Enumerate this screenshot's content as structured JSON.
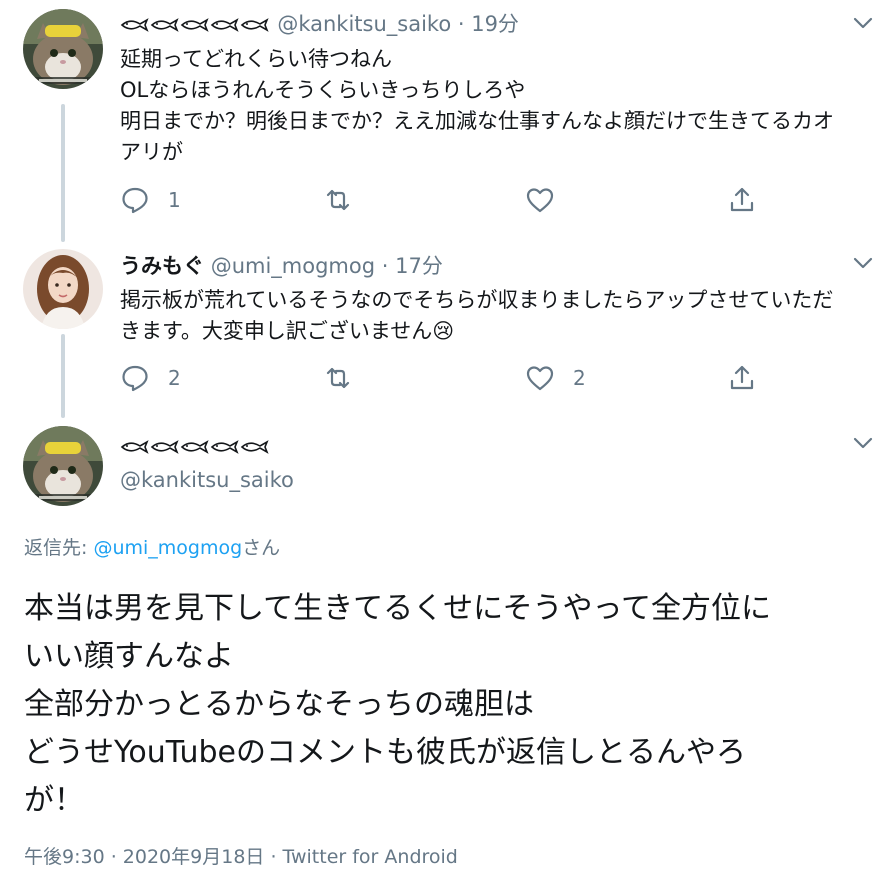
{
  "tweets": [
    {
      "display_name": "🐟🐟🐟🐟🐟",
      "handle": "@kankitsu_saiko",
      "time": "· 19分",
      "lines": [
        "延期ってどれくらい待つねん",
        "OLならほうれんそうくらいきっちりしろや",
        "明日までか？明後日までか？ええ加減な仕事すんなよ顔だけで生きてるカオ",
        "アリが"
      ],
      "reply_count": "1",
      "like_count": ""
    },
    {
      "display_name": "うみもぐ",
      "handle": "@umi_mogmog",
      "time": "· 17分",
      "lines": [
        "掲示板が荒れているそうなのでそちらが収まりましたらアップさせていただ",
        "きます。大変申し訳ございません😢"
      ],
      "reply_count": "2",
      "like_count": "2"
    }
  ],
  "main_tweet": {
    "display_name": "🐟🐟🐟🐟🐟",
    "handle": "@kankitsu_saiko",
    "reply_prefix": "返信先: ",
    "reply_handle": "@umi_mogmog",
    "reply_suffix": "さん",
    "lines": [
      "本当は男を見下して生きてるくせにそうやって全方位に",
      "いい顔すんなよ",
      "全部分かっとるからなそっちの魂胆は",
      "どうせYouTubeのコメントも彼氏が返信しとるんやろ",
      "が！"
    ],
    "meta": "午後9:30 · 2020年9月18日 · Twitter for Android"
  },
  "icons": {
    "reply": "reply-icon",
    "retweet": "retweet-icon",
    "like": "heart-icon",
    "share": "share-icon",
    "more": "chevron-down-icon"
  },
  "colors": {
    "text": "#14171a",
    "muted": "#657786",
    "link": "#1da1f2",
    "thread_line": "#ccd6dd"
  }
}
